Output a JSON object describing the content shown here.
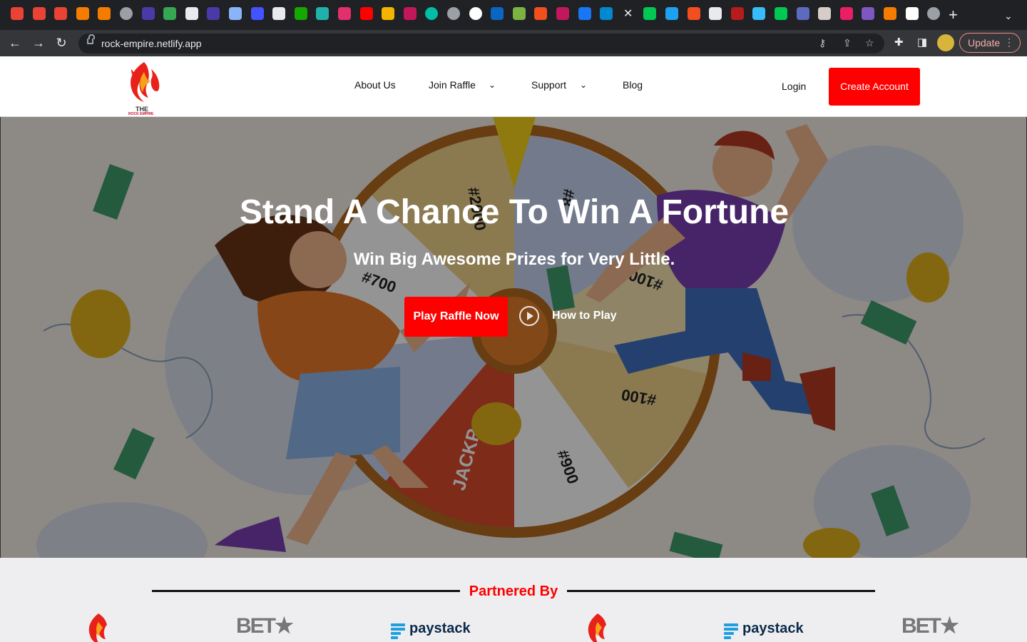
{
  "browser": {
    "url": "rock-empire.netlify.app",
    "update_label": "Update",
    "tab_favicons": [
      "gmail",
      "gmail",
      "gmail",
      "box",
      "link",
      "globe",
      "spark",
      "drive",
      "x-box",
      "spark",
      "shield",
      "webflow",
      "seven",
      "upwork",
      "diamond",
      "instagram",
      "youtube",
      "mountain",
      "m-logo",
      "circle",
      "globe",
      "info",
      "linkedin",
      "green",
      "figma",
      "m-logo",
      "facebook",
      "video",
      "close",
      "w",
      "twitter",
      "figma",
      "github",
      "red",
      "tailwind",
      "w",
      "arch",
      "photo",
      "stars",
      "purple",
      "box",
      "white",
      "globe"
    ]
  },
  "site": {
    "logo_line1": "THE",
    "logo_line2": "ROCK EMPIRE",
    "nav": {
      "about": "About Us",
      "join": "Join Raffle",
      "support": "Support",
      "blog": "Blog"
    },
    "login": "Login",
    "create_account": "Create Account"
  },
  "hero": {
    "title": "Stand A Chance To Win A Fortune",
    "subtitle": "Win Big Awesome Prizes for Very Little.",
    "play_button": "Play Raffle Now",
    "how_to_play": "How to Play",
    "wheel_labels": [
      "#2000",
      "#8",
      "#700",
      "#1000",
      "#5000",
      "#100",
      "JACKP",
      "#900"
    ]
  },
  "partners": {
    "title": "Partnered By",
    "logos": [
      "rock-empire",
      "BET★",
      "paystack",
      "rock-empire",
      "paystack",
      "BET★"
    ]
  },
  "colors": {
    "brand_red": "#ff0000",
    "chrome_dark": "#202124",
    "partners_bg": "#eeeef0"
  }
}
